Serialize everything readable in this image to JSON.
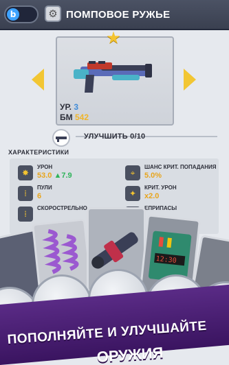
{
  "header": {
    "title": "ПОМПОВОЕ РУЖЬЕ",
    "toggle_icon": "lock-icon",
    "settings_icon": "gear-icon"
  },
  "weapon": {
    "level_label": "УР.",
    "level_value": "3",
    "power_label": "БМ",
    "power_value": "542"
  },
  "upgrade": {
    "label": "УЛУЧШИТЬ 0/10"
  },
  "stats_section": {
    "title": "ХАРАКТЕРИСТИКИ",
    "items": [
      {
        "label": "УРОН",
        "value": "53.0",
        "bonus": "7.9",
        "icon": "explosion-icon"
      },
      {
        "label": "ШАНС КРИТ. ПОПАДАНИЯ",
        "value": "5.0%",
        "icon": "crosshair-icon"
      },
      {
        "label": "ПУЛИ",
        "value": "6",
        "icon": "bullets-icon"
      },
      {
        "label": "КРИТ. УРОН",
        "value": "x2.0",
        "icon": "crit-icon"
      },
      {
        "label": "СКОРОСТРЕЛЬНО",
        "value": "",
        "icon": "bullets-icon"
      },
      {
        "label": "ЕПРИПАСЫ",
        "value": "",
        "icon": "ammo-icon"
      }
    ]
  },
  "promo": {
    "line1": "ПОПОЛНЯЙТЕ И УЛУЧШАЙТЕ",
    "line2": "ОРУЖИЯ"
  },
  "colors": {
    "accent_yellow": "#f2c633",
    "value_orange": "#e8a51c",
    "value_blue": "#3f8bd8",
    "bonus_green": "#2fb35a",
    "banner_purple": "#4a1f72"
  }
}
